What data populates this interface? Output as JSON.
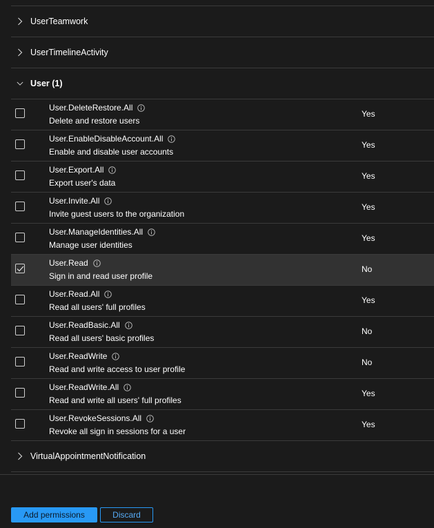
{
  "groups_top": [
    {
      "label": "UserTeamwork"
    },
    {
      "label": "UserTimelineActivity"
    }
  ],
  "user_group": {
    "label": "User (1)"
  },
  "permissions": [
    {
      "name": "User.DeleteRestore.All",
      "desc": "Delete and restore users",
      "admin": "Yes",
      "checked": false
    },
    {
      "name": "User.EnableDisableAccount.All",
      "desc": "Enable and disable user accounts",
      "admin": "Yes",
      "checked": false
    },
    {
      "name": "User.Export.All",
      "desc": "Export user's data",
      "admin": "Yes",
      "checked": false
    },
    {
      "name": "User.Invite.All",
      "desc": "Invite guest users to the organization",
      "admin": "Yes",
      "checked": false
    },
    {
      "name": "User.ManageIdentities.All",
      "desc": "Manage user identities",
      "admin": "Yes",
      "checked": false
    },
    {
      "name": "User.Read",
      "desc": "Sign in and read user profile",
      "admin": "No",
      "checked": true
    },
    {
      "name": "User.Read.All",
      "desc": "Read all users' full profiles",
      "admin": "Yes",
      "checked": false
    },
    {
      "name": "User.ReadBasic.All",
      "desc": "Read all users' basic profiles",
      "admin": "No",
      "checked": false
    },
    {
      "name": "User.ReadWrite",
      "desc": "Read and write access to user profile",
      "admin": "No",
      "checked": false
    },
    {
      "name": "User.ReadWrite.All",
      "desc": "Read and write all users' full profiles",
      "admin": "Yes",
      "checked": false
    },
    {
      "name": "User.RevokeSessions.All",
      "desc": "Revoke all sign in sessions for a user",
      "admin": "Yes",
      "checked": false
    }
  ],
  "groups_bottom": [
    {
      "label": "VirtualAppointmentNotification"
    }
  ],
  "footer": {
    "add_label": "Add permissions",
    "discard_label": "Discard"
  },
  "colors": {
    "background": "#1b1b1b",
    "selected_row": "#323232",
    "divider": "#3b3b3b",
    "primary": "#2899f5"
  }
}
